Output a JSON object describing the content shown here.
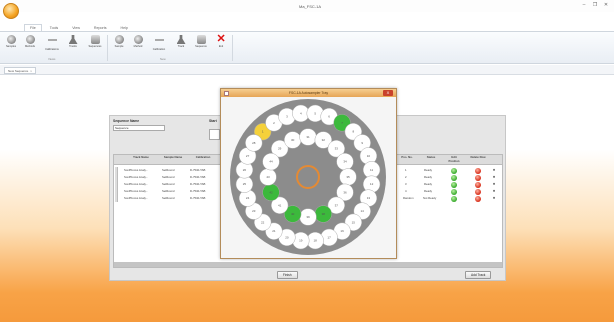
{
  "window": {
    "title": "Ma_FSC-1A"
  },
  "menu_tabs": [
    "File",
    "Tools",
    "View",
    "Reports",
    "Help"
  ],
  "ribbon": {
    "buttons": [
      {
        "label": "Samples",
        "icon": "disc-icon"
      },
      {
        "label": "Methods",
        "icon": "disc-icon"
      },
      {
        "label": "Calibrations",
        "icon": "dash-icon"
      },
      {
        "label": "Tracks",
        "icon": "flask-icon"
      },
      {
        "label": "Sequences",
        "icon": "tray-icon"
      },
      {
        "label": "Sample",
        "icon": "disc-icon"
      },
      {
        "label": "Method",
        "icon": "disc-icon"
      },
      {
        "label": "Calibration",
        "icon": "dash-icon"
      },
      {
        "label": "Track",
        "icon": "flask-icon"
      },
      {
        "label": "Sequence",
        "icon": "tray-icon"
      },
      {
        "label": "Exit",
        "icon": "close-icon"
      }
    ],
    "groups": [
      "Views",
      "New"
    ]
  },
  "doc_tab": {
    "label": "New Sequence",
    "close": "x"
  },
  "panel": {
    "sequence_name_label": "Sequence Name",
    "sequence_name_value": "Sequence",
    "spin_label": "Start",
    "columns": [
      "Track Name",
      "Sample Name",
      "Calibration",
      "Pos. No.",
      "Status",
      "Edit Position",
      "Delete Row"
    ],
    "rows": [
      {
        "track": "SoxPFocus Analy...",
        "sample": "SetRound",
        "calibration": "D-7540-TAB",
        "pos": "1",
        "status": "Ready"
      },
      {
        "track": "SoxPFocus Analy...",
        "sample": "SetRound",
        "calibration": "D-7540-TAB",
        "pos": "2",
        "status": "Ready"
      },
      {
        "track": "SoxPFocus Analy...",
        "sample": "SetRound",
        "calibration": "D-7540-TAB",
        "pos": "3",
        "status": "Ready"
      },
      {
        "track": "SoxPFocus Analy...",
        "sample": "SetRound",
        "calibration": "D-7540-TAB",
        "pos": "4",
        "status": "Ready"
      },
      {
        "track": "SoxPFocus Analy...",
        "sample": "SetRound",
        "calibration": "D-7540-TAB",
        "pos": "Random",
        "status": "Not Ready"
      }
    ],
    "start_button": "Finish",
    "edit_button": "Add Track"
  },
  "dialog": {
    "title": "FSC-1A Autosampler Tray",
    "close": "X",
    "vial_color": "#ffffff",
    "tray_color": "#8c8c8c",
    "highlight_green": "#3cb93c",
    "highlight_yellow": "#f5d13a",
    "center_ring_color": "#e58a33",
    "vials": [
      {
        "n": "1",
        "state": "yellow"
      },
      {
        "n": "2",
        "state": "empty"
      },
      {
        "n": "3",
        "state": "empty"
      },
      {
        "n": "4",
        "state": "empty"
      },
      {
        "n": "5",
        "state": "empty"
      },
      {
        "n": "6",
        "state": "empty"
      },
      {
        "n": "7",
        "state": "green"
      },
      {
        "n": "8",
        "state": "empty"
      },
      {
        "n": "9",
        "state": "empty"
      },
      {
        "n": "10",
        "state": "empty"
      },
      {
        "n": "11",
        "state": "empty"
      },
      {
        "n": "12",
        "state": "empty"
      },
      {
        "n": "13",
        "state": "empty"
      },
      {
        "n": "14",
        "state": "empty"
      },
      {
        "n": "15",
        "state": "empty"
      },
      {
        "n": "16",
        "state": "empty"
      },
      {
        "n": "17",
        "state": "empty"
      },
      {
        "n": "18",
        "state": "empty"
      },
      {
        "n": "19",
        "state": "empty"
      },
      {
        "n": "20",
        "state": "empty"
      },
      {
        "n": "21",
        "state": "empty"
      },
      {
        "n": "22",
        "state": "empty"
      },
      {
        "n": "23",
        "state": "empty"
      },
      {
        "n": "24",
        "state": "empty"
      },
      {
        "n": "25",
        "state": "empty"
      },
      {
        "n": "26",
        "state": "empty"
      },
      {
        "n": "27",
        "state": "empty"
      },
      {
        "n": "28",
        "state": "empty"
      },
      {
        "n": "29",
        "state": "empty"
      },
      {
        "n": "30",
        "state": "empty"
      },
      {
        "n": "31",
        "state": "empty"
      },
      {
        "n": "32",
        "state": "empty"
      },
      {
        "n": "33",
        "state": "empty"
      },
      {
        "n": "34",
        "state": "empty"
      },
      {
        "n": "35",
        "state": "empty"
      },
      {
        "n": "36",
        "state": "empty"
      },
      {
        "n": "37",
        "state": "empty"
      },
      {
        "n": "38",
        "state": "green"
      },
      {
        "n": "39",
        "state": "empty"
      },
      {
        "n": "40",
        "state": "green"
      },
      {
        "n": "41",
        "state": "empty"
      },
      {
        "n": "42",
        "state": "green"
      },
      {
        "n": "43",
        "state": "empty"
      },
      {
        "n": "44",
        "state": "empty"
      }
    ]
  },
  "colors": {
    "accent_orange": "#f59a3c",
    "ribbon_bg": "#e9eef4"
  }
}
